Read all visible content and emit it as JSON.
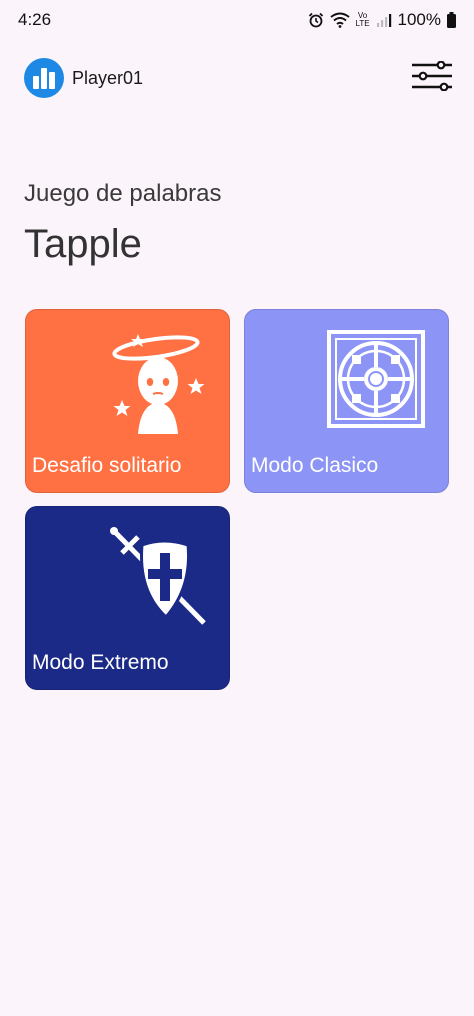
{
  "status_bar": {
    "time": "4:26",
    "battery": "100%",
    "icons": [
      "alarm-icon",
      "wifi-icon",
      "volte-icon",
      "signal-icon",
      "battery-icon"
    ],
    "volte_text": "Vo LTE"
  },
  "header": {
    "username": "Player01",
    "avatar_icon": "bar-chart-icon",
    "settings_icon": "sliders-icon"
  },
  "page": {
    "subtitle": "Juego de palabras",
    "title": "Tapple"
  },
  "modes": [
    {
      "label": "Desafio solitario",
      "color": "#ff7043",
      "icon": "dizzy-head-icon"
    },
    {
      "label": "Modo Clasico",
      "color": "#8c95f5",
      "icon": "board-icon"
    },
    {
      "label": "Modo Extremo",
      "color": "#1b2a86",
      "icon": "shield-sword-icon"
    }
  ],
  "colors": {
    "background": "#fcf4fb",
    "avatar": "#1e88e5"
  }
}
